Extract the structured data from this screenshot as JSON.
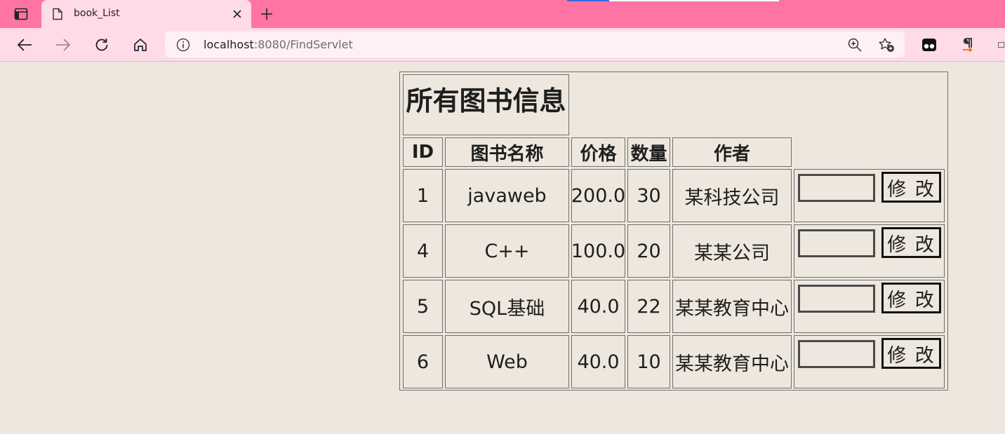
{
  "browser": {
    "tab": {
      "title": "book_List"
    },
    "address_bar": {
      "url_host": "localhost",
      "url_rest": ":8080/FindServlet"
    },
    "colors": {
      "tabbar": "#ff74a4",
      "toolbar": "#ffdbe8",
      "page_background": "#ede7dd"
    }
  },
  "page": {
    "table_caption": "所有图书信息",
    "columns": [
      "ID",
      "图书名称",
      "价格",
      "数量",
      "作者"
    ],
    "rows": [
      {
        "id": "1",
        "name": "javaweb",
        "price": "200.0",
        "quantity": "30",
        "author": "某科技公司",
        "input_value": "",
        "button_label": "修 改"
      },
      {
        "id": "4",
        "name": "C++",
        "price": "100.0",
        "quantity": "20",
        "author": "某某公司",
        "input_value": "",
        "button_label": "修 改"
      },
      {
        "id": "5",
        "name": "SQL基础",
        "price": "40.0",
        "quantity": "22",
        "author": "某某教育中心",
        "input_value": "",
        "button_label": "修 改"
      },
      {
        "id": "6",
        "name": "Web",
        "price": "40.0",
        "quantity": "10",
        "author": "某某教育中心",
        "input_value": "",
        "button_label": "修 改"
      }
    ]
  }
}
